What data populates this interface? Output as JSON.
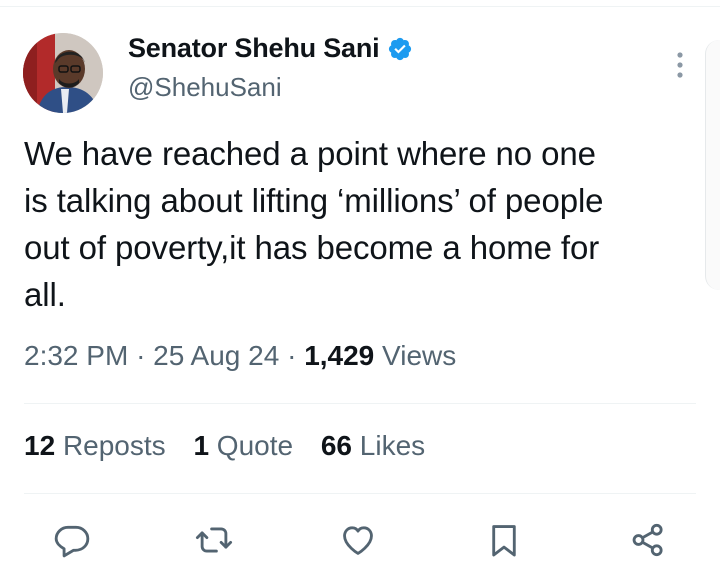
{
  "author": {
    "display_name": "Senator Shehu Sani",
    "handle": "@ShehuSani",
    "verified": true
  },
  "tweet": {
    "text": "We have reached a point where no one\nis talking about lifting ‘millions’ of people\nout of poverty,it has become a home for\nall."
  },
  "meta": {
    "time": "2:32 PM",
    "separator": "·",
    "date": "25 Aug 24",
    "views_count": "1,429",
    "views_label": "Views"
  },
  "stats": {
    "reposts_count": "12",
    "reposts_label": "Reposts",
    "quotes_count": "1",
    "quotes_label": "Quote",
    "likes_count": "66",
    "likes_label": "Likes"
  },
  "icons": {
    "reply": "reply-icon",
    "repost": "repost-icon",
    "like": "heart-icon",
    "bookmark": "bookmark-icon",
    "share": "share-icon",
    "more": "more-vertical-icon",
    "verified": "verified-badge-icon"
  },
  "colors": {
    "text_primary": "#0f1419",
    "text_secondary": "#536471",
    "verified_blue": "#1d9bf0",
    "divider": "#eff3f4"
  }
}
